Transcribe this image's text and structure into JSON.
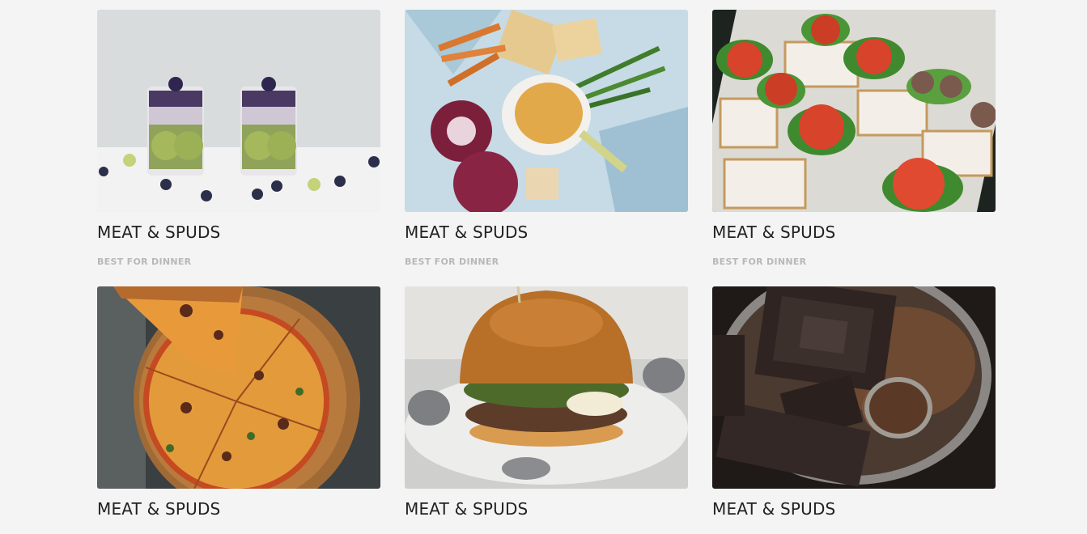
{
  "cards": [
    {
      "title": "MEAT & SPUDS",
      "subtitle": "BEST FOR DINNER",
      "image": "kiwi-blueberry-parfait-image"
    },
    {
      "title": "MEAT & SPUDS",
      "subtitle": "BEST FOR DINNER",
      "image": "appetizer-platter-image"
    },
    {
      "title": "MEAT & SPUDS",
      "subtitle": "BEST FOR DINNER",
      "image": "open-sandwiches-image"
    },
    {
      "title": "MEAT & SPUDS",
      "subtitle": "",
      "image": "pizza-slice-image"
    },
    {
      "title": "MEAT & SPUDS",
      "subtitle": "",
      "image": "burger-image"
    },
    {
      "title": "MEAT & SPUDS",
      "subtitle": "",
      "image": "dark-chocolate-image"
    }
  ]
}
